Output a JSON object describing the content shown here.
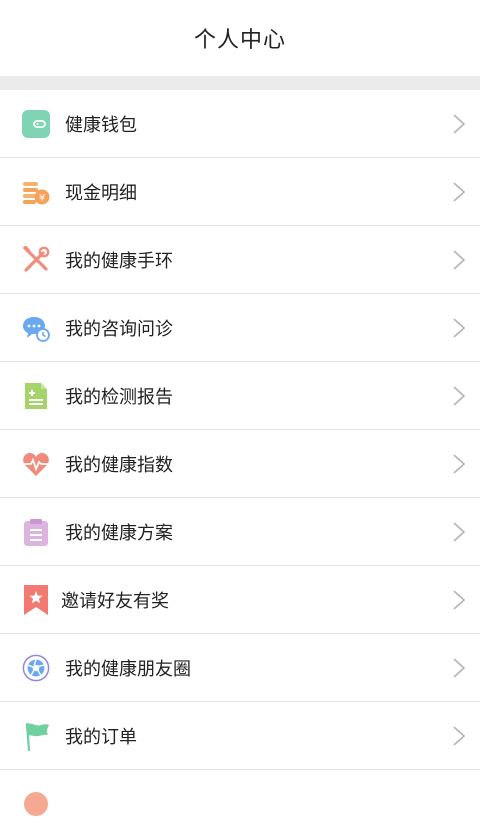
{
  "header": {
    "title": "个人中心"
  },
  "menu": {
    "items": [
      {
        "id": "wallet",
        "label": "健康钱包",
        "icon": "wallet-icon",
        "color": "#7fd4b4"
      },
      {
        "id": "cash",
        "label": "现金明细",
        "icon": "coins-icon",
        "color": "#f5a35a"
      },
      {
        "id": "band",
        "label": "我的健康手环",
        "icon": "tools-icon",
        "color": "#f28c7c"
      },
      {
        "id": "consult",
        "label": "我的咨询问诊",
        "icon": "chat-clock-icon",
        "color": "#6aa9f0"
      },
      {
        "id": "report",
        "label": "我的检测报告",
        "icon": "document-plus-icon",
        "color": "#a7d46a"
      },
      {
        "id": "index",
        "label": "我的健康指数",
        "icon": "heart-pulse-icon",
        "color": "#f08a7a"
      },
      {
        "id": "plan",
        "label": "我的健康方案",
        "icon": "clipboard-icon",
        "color": "#dcb4e0"
      },
      {
        "id": "invite",
        "label": "邀请好友有奖",
        "icon": "bookmark-star-icon",
        "color": "#f27a70"
      },
      {
        "id": "circle",
        "label": "我的健康朋友圈",
        "icon": "aperture-icon",
        "color": "#8f86e6"
      },
      {
        "id": "orders",
        "label": "我的订单",
        "icon": "flag-icon",
        "color": "#6fd0a0"
      }
    ]
  }
}
